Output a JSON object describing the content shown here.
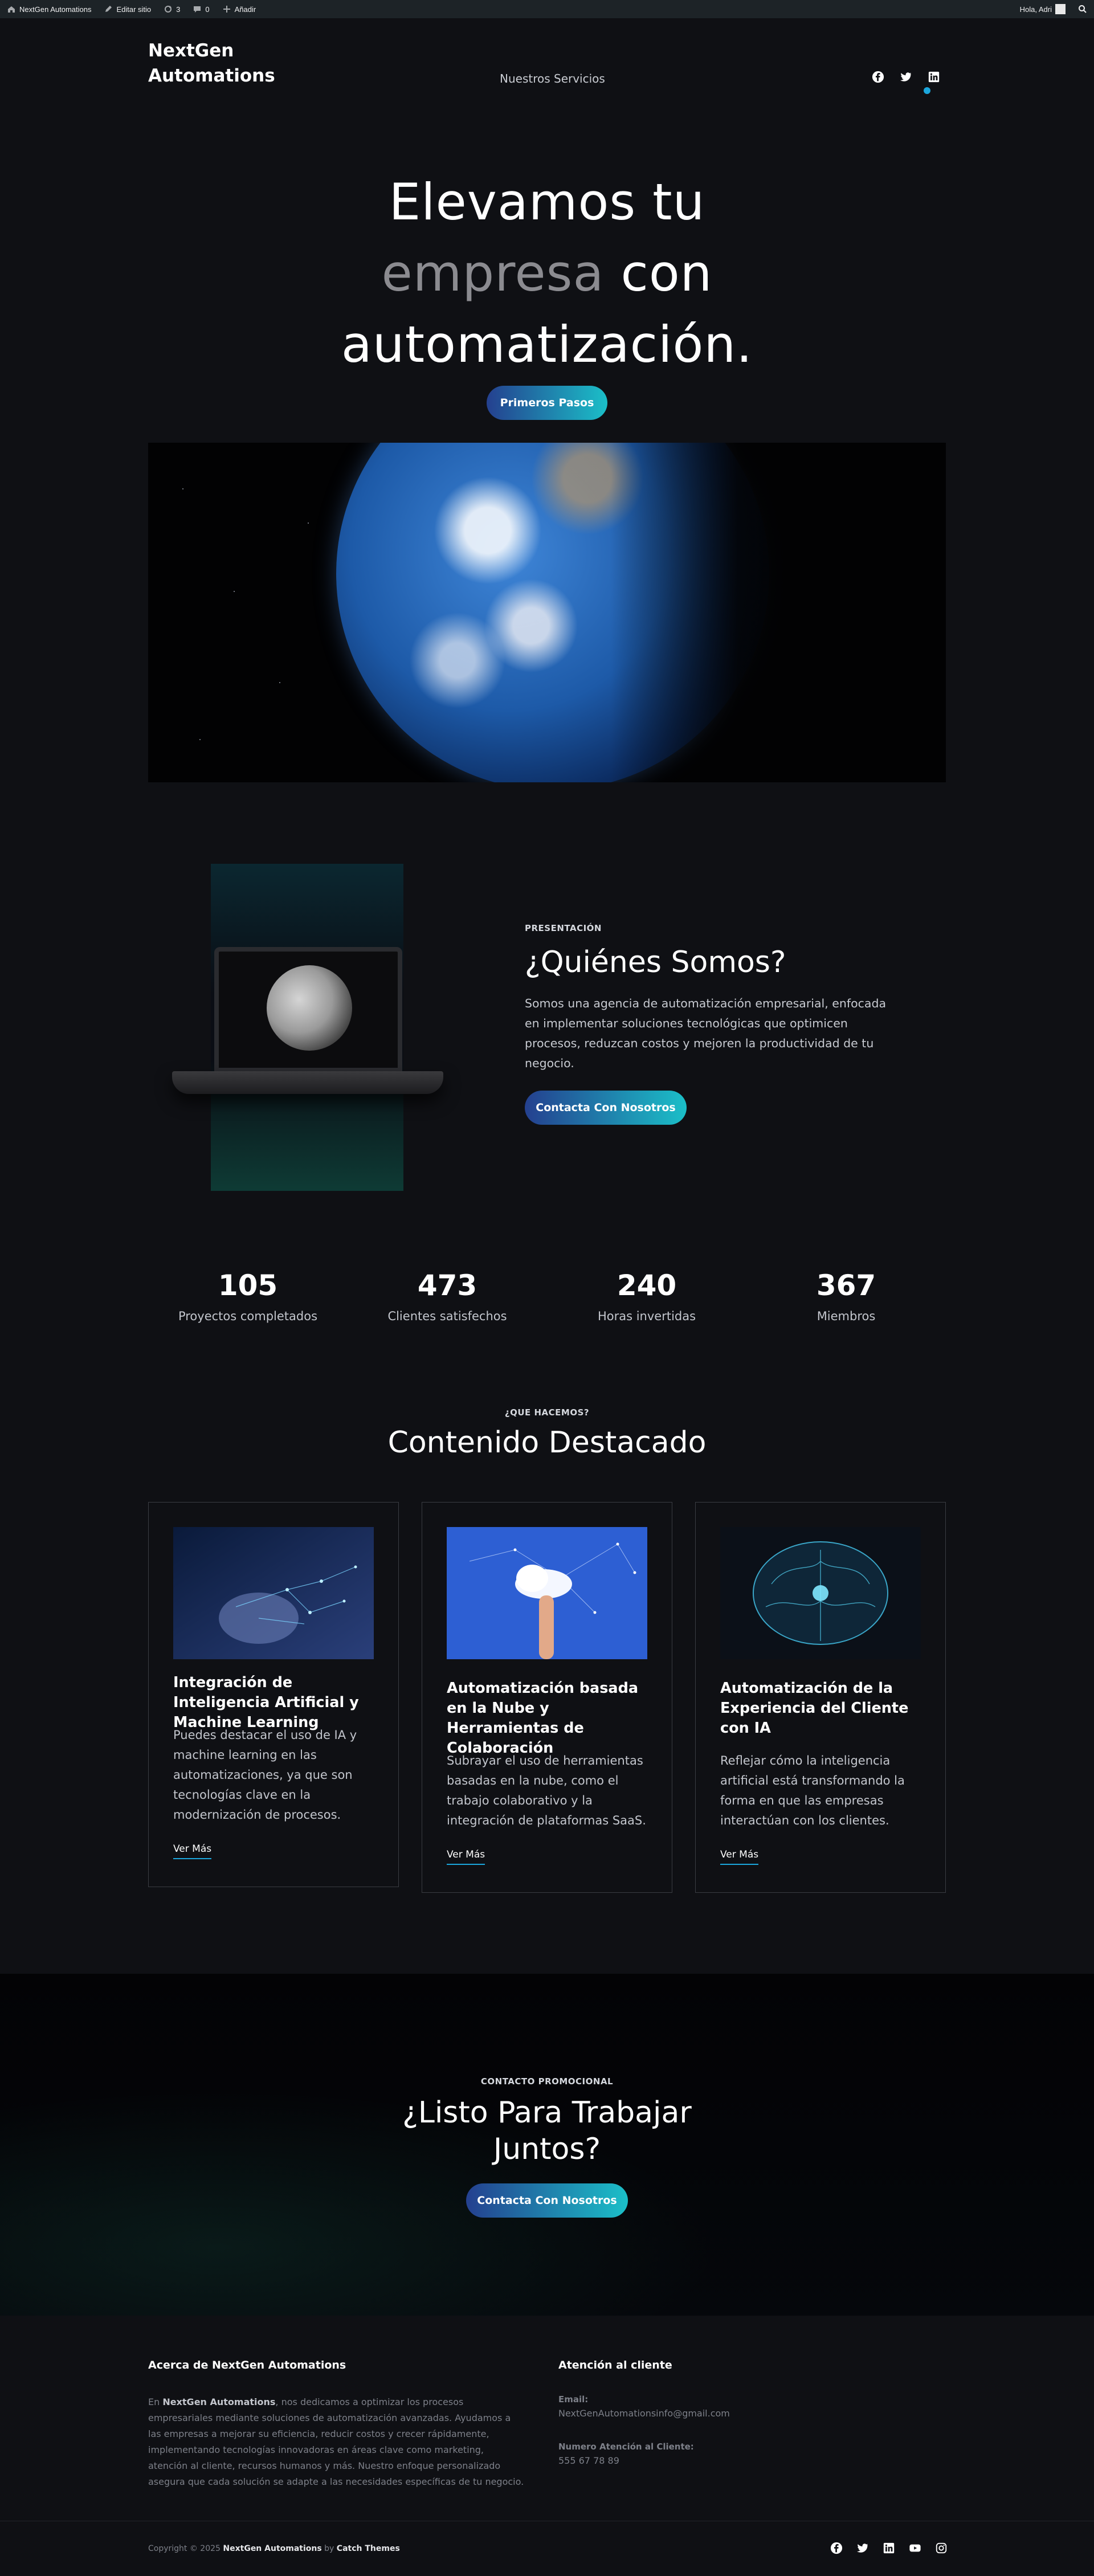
{
  "admin_bar": {
    "site_name": "NextGen Automations",
    "edit_site": "Editar sitio",
    "updates_count": "3",
    "comments_count": "0",
    "add_new": "Añadir",
    "greeting": "Hola, Adri"
  },
  "header": {
    "brand_line1": "NextGen",
    "brand_line2": "Automations",
    "nav_item": "Nuestros Servicios",
    "social_icons": [
      "facebook-icon",
      "twitter-icon",
      "linkedin-icon"
    ]
  },
  "hero": {
    "line1": "Elevamos tu",
    "line2_muted": "empresa",
    "line2_rest": "con",
    "line3": "automatización.",
    "cta": "Primeros Pasos"
  },
  "about": {
    "eyebrow": "PRESENTACIÓN",
    "title": "¿Quiénes Somos?",
    "body": "Somos una agencia de automatización empresarial, enfocada en implementar soluciones tecnológicas que optimicen procesos, reduzcan costos y mejoren la productividad de tu negocio.",
    "cta": "Contacta Con Nosotros"
  },
  "stats": [
    {
      "number": "105",
      "label": "Proyectos completados"
    },
    {
      "number": "473",
      "label": "Clientes satisfechos"
    },
    {
      "number": "240",
      "label": "Horas invertidas"
    },
    {
      "number": "367",
      "label": "Miembros"
    }
  ],
  "features": {
    "eyebrow": "¿QUE HACEMOS?",
    "title": "Contenido Destacado",
    "cards": [
      {
        "title": "Integración de Inteligencia Artificial y Machine Learning",
        "body": "Puedes destacar el uso de IA y machine learning en las automatizaciones, ya que son tecnologías clave en la modernización de procesos.",
        "link": "Ver Más"
      },
      {
        "title": "Automatización basada en la Nube y Herramientas de Colaboración",
        "body": "Subrayar el uso de herramientas basadas en la nube, como el trabajo colaborativo y la integración de plataformas SaaS.",
        "link": "Ver Más"
      },
      {
        "title": "Automatización de la Experiencia del Cliente con IA",
        "body": "Reflejar cómo la inteligencia artificial está transformando la forma en que las empresas interactúan con los clientes.",
        "link": "Ver Más"
      }
    ]
  },
  "promo": {
    "eyebrow": "CONTACTO PROMOCIONAL",
    "title_line1": "¿Listo Para Trabajar",
    "title_line2": "Juntos?",
    "cta": "Contacta Con Nosotros"
  },
  "footer": {
    "about_title": "Acerca de NextGen Automations",
    "about_prefix": "En ",
    "about_brand": "NextGen Automations",
    "about_text": ", nos dedicamos a optimizar los procesos empresariales mediante soluciones de automatización avanzadas. Ayudamos a las empresas a mejorar su eficiencia, reducir costos y crecer rápidamente, implementando tecnologías innovadoras en áreas clave como marketing, atención al cliente, recursos humanos y más. Nuestro enfoque personalizado asegura que cada solución se adapte a las necesidades específicas de tu negocio.",
    "support_title": "Atención al cliente",
    "email_label": "Email:",
    "email_value": "NextGenAutomationsinfo@gmail.com",
    "phone_label": "Numero Atención al Cliente:",
    "phone_value": "555 67 78 89",
    "copyright_prefix": "Copyright © 2025",
    "copyright_brand": "NextGen Automations",
    "copyright_by": "by",
    "copyright_theme": "Catch Themes",
    "social_icons": [
      "facebook-icon",
      "twitter-icon",
      "linkedin-icon",
      "youtube-icon",
      "instagram-icon"
    ]
  },
  "colors": {
    "background": "#0f1014",
    "accent_start": "#24408f",
    "accent_end": "#1bbfc8",
    "link_underline": "#1ba6dc"
  }
}
